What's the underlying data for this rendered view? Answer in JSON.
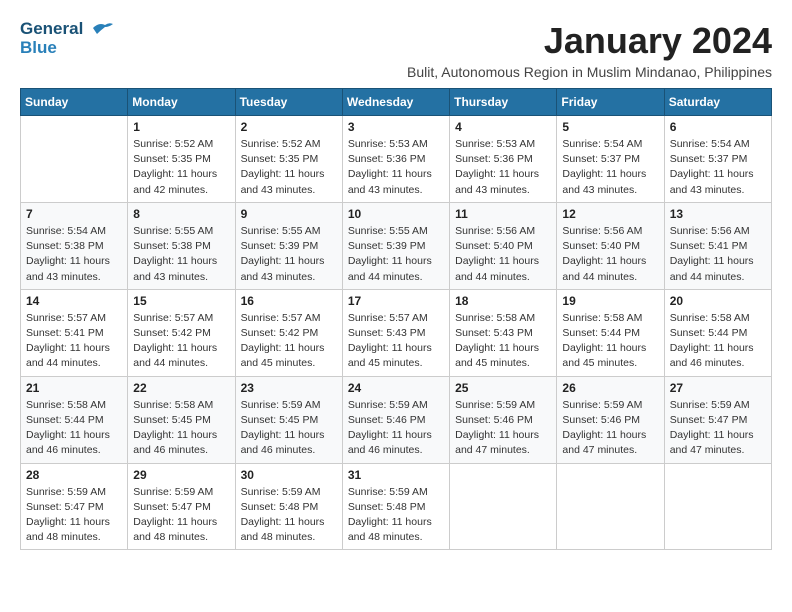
{
  "logo": {
    "line1": "General",
    "line2": "Blue"
  },
  "title": "January 2024",
  "subtitle": "Bulit, Autonomous Region in Muslim Mindanao, Philippines",
  "days_header": [
    "Sunday",
    "Monday",
    "Tuesday",
    "Wednesday",
    "Thursday",
    "Friday",
    "Saturday"
  ],
  "weeks": [
    [
      {
        "num": "",
        "info": ""
      },
      {
        "num": "1",
        "info": "Sunrise: 5:52 AM\nSunset: 5:35 PM\nDaylight: 11 hours\nand 42 minutes."
      },
      {
        "num": "2",
        "info": "Sunrise: 5:52 AM\nSunset: 5:35 PM\nDaylight: 11 hours\nand 43 minutes."
      },
      {
        "num": "3",
        "info": "Sunrise: 5:53 AM\nSunset: 5:36 PM\nDaylight: 11 hours\nand 43 minutes."
      },
      {
        "num": "4",
        "info": "Sunrise: 5:53 AM\nSunset: 5:36 PM\nDaylight: 11 hours\nand 43 minutes."
      },
      {
        "num": "5",
        "info": "Sunrise: 5:54 AM\nSunset: 5:37 PM\nDaylight: 11 hours\nand 43 minutes."
      },
      {
        "num": "6",
        "info": "Sunrise: 5:54 AM\nSunset: 5:37 PM\nDaylight: 11 hours\nand 43 minutes."
      }
    ],
    [
      {
        "num": "7",
        "info": "Sunrise: 5:54 AM\nSunset: 5:38 PM\nDaylight: 11 hours\nand 43 minutes."
      },
      {
        "num": "8",
        "info": "Sunrise: 5:55 AM\nSunset: 5:38 PM\nDaylight: 11 hours\nand 43 minutes."
      },
      {
        "num": "9",
        "info": "Sunrise: 5:55 AM\nSunset: 5:39 PM\nDaylight: 11 hours\nand 43 minutes."
      },
      {
        "num": "10",
        "info": "Sunrise: 5:55 AM\nSunset: 5:39 PM\nDaylight: 11 hours\nand 44 minutes."
      },
      {
        "num": "11",
        "info": "Sunrise: 5:56 AM\nSunset: 5:40 PM\nDaylight: 11 hours\nand 44 minutes."
      },
      {
        "num": "12",
        "info": "Sunrise: 5:56 AM\nSunset: 5:40 PM\nDaylight: 11 hours\nand 44 minutes."
      },
      {
        "num": "13",
        "info": "Sunrise: 5:56 AM\nSunset: 5:41 PM\nDaylight: 11 hours\nand 44 minutes."
      }
    ],
    [
      {
        "num": "14",
        "info": "Sunrise: 5:57 AM\nSunset: 5:41 PM\nDaylight: 11 hours\nand 44 minutes."
      },
      {
        "num": "15",
        "info": "Sunrise: 5:57 AM\nSunset: 5:42 PM\nDaylight: 11 hours\nand 44 minutes."
      },
      {
        "num": "16",
        "info": "Sunrise: 5:57 AM\nSunset: 5:42 PM\nDaylight: 11 hours\nand 45 minutes."
      },
      {
        "num": "17",
        "info": "Sunrise: 5:57 AM\nSunset: 5:43 PM\nDaylight: 11 hours\nand 45 minutes."
      },
      {
        "num": "18",
        "info": "Sunrise: 5:58 AM\nSunset: 5:43 PM\nDaylight: 11 hours\nand 45 minutes."
      },
      {
        "num": "19",
        "info": "Sunrise: 5:58 AM\nSunset: 5:44 PM\nDaylight: 11 hours\nand 45 minutes."
      },
      {
        "num": "20",
        "info": "Sunrise: 5:58 AM\nSunset: 5:44 PM\nDaylight: 11 hours\nand 46 minutes."
      }
    ],
    [
      {
        "num": "21",
        "info": "Sunrise: 5:58 AM\nSunset: 5:44 PM\nDaylight: 11 hours\nand 46 minutes."
      },
      {
        "num": "22",
        "info": "Sunrise: 5:58 AM\nSunset: 5:45 PM\nDaylight: 11 hours\nand 46 minutes."
      },
      {
        "num": "23",
        "info": "Sunrise: 5:59 AM\nSunset: 5:45 PM\nDaylight: 11 hours\nand 46 minutes."
      },
      {
        "num": "24",
        "info": "Sunrise: 5:59 AM\nSunset: 5:46 PM\nDaylight: 11 hours\nand 46 minutes."
      },
      {
        "num": "25",
        "info": "Sunrise: 5:59 AM\nSunset: 5:46 PM\nDaylight: 11 hours\nand 47 minutes."
      },
      {
        "num": "26",
        "info": "Sunrise: 5:59 AM\nSunset: 5:46 PM\nDaylight: 11 hours\nand 47 minutes."
      },
      {
        "num": "27",
        "info": "Sunrise: 5:59 AM\nSunset: 5:47 PM\nDaylight: 11 hours\nand 47 minutes."
      }
    ],
    [
      {
        "num": "28",
        "info": "Sunrise: 5:59 AM\nSunset: 5:47 PM\nDaylight: 11 hours\nand 48 minutes."
      },
      {
        "num": "29",
        "info": "Sunrise: 5:59 AM\nSunset: 5:47 PM\nDaylight: 11 hours\nand 48 minutes."
      },
      {
        "num": "30",
        "info": "Sunrise: 5:59 AM\nSunset: 5:48 PM\nDaylight: 11 hours\nand 48 minutes."
      },
      {
        "num": "31",
        "info": "Sunrise: 5:59 AM\nSunset: 5:48 PM\nDaylight: 11 hours\nand 48 minutes."
      },
      {
        "num": "",
        "info": ""
      },
      {
        "num": "",
        "info": ""
      },
      {
        "num": "",
        "info": ""
      }
    ]
  ]
}
